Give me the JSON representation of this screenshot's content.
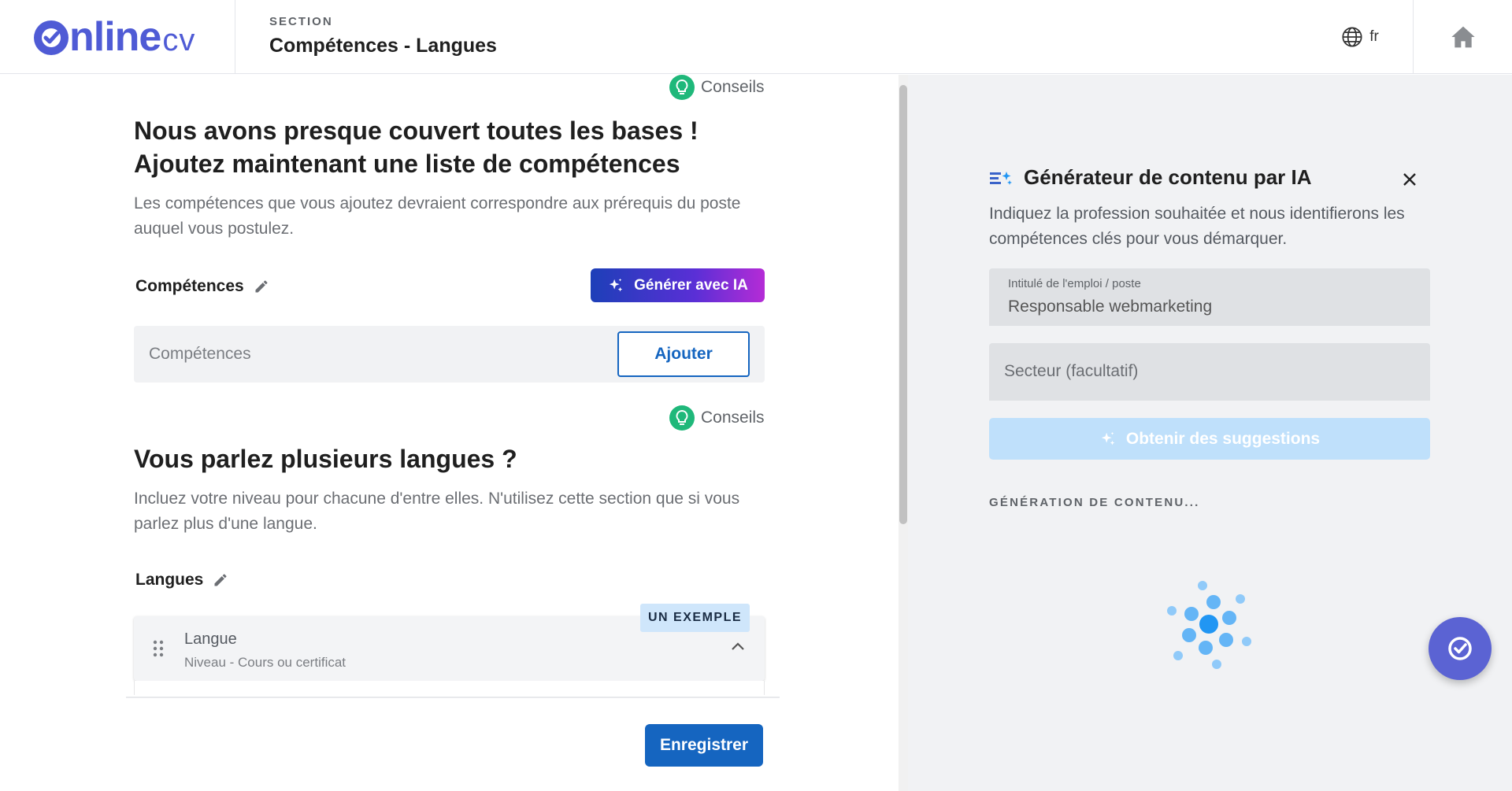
{
  "header": {
    "logo": {
      "main": "nline",
      "suffix": "cv",
      "brand_color": "#4f5bd5"
    },
    "section_label": "SECTION",
    "section_title": "Compétences - Langues",
    "language": "fr",
    "icons": {
      "globe": "globe-icon",
      "home": "home-icon"
    }
  },
  "skills_section": {
    "tips_label": "Conseils",
    "heading_line1": "Nous avons presque couvert toutes les bases !",
    "heading_line2": "Ajoutez maintenant une liste de compétences",
    "description": "Les compétences que vous ajoutez devraient correspondre aux prérequis du poste auquel vous postulez.",
    "field_label": "Compétences",
    "ai_button": "Générer avec IA",
    "input_placeholder": "Compétences",
    "input_value": "",
    "add_button": "Ajouter"
  },
  "languages_section": {
    "tips_label": "Conseils",
    "heading": "Vous parlez plusieurs langues ?",
    "description": "Incluez votre niveau pour chacune d'entre elles. N'utilisez cette section que si vous parlez plus d'une langue.",
    "field_label": "Langues",
    "example_badge": "UN EXEMPLE",
    "card_title": "Langue",
    "card_subtitle": "Niveau - Cours ou certificat"
  },
  "save_button": "Enregistrer",
  "ai_panel": {
    "title": "Générateur de contenu par IA",
    "description": "Indiquez la profession souhaitée et nous identifierons les compétences clés pour vous démarquer.",
    "job_field_label": "Intitulé de l'emploi / poste",
    "job_field_value": "Responsable webmarketing",
    "sector_placeholder": "Secteur (facultatif)",
    "suggest_button": "Obtenir des suggestions",
    "generation_label": "GÉNÉRATION DE CONTENU...",
    "accent_color": "#2196f3"
  },
  "colors": {
    "primary": "#1565c0",
    "tips_green": "#1fb87a",
    "badge_bg": "#cfe6fb",
    "panel_bg": "#f1f2f4"
  }
}
